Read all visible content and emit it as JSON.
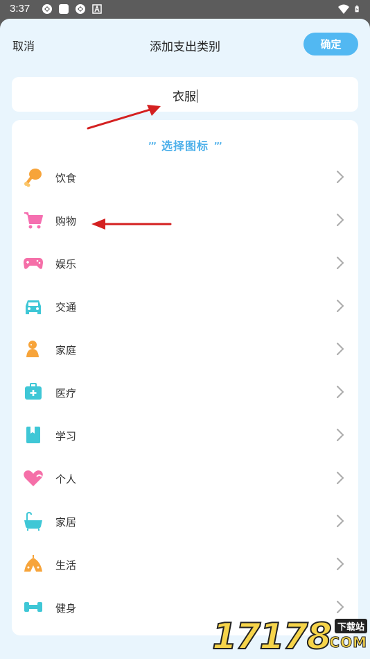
{
  "status_bar": {
    "time": "3:37",
    "left_icons": [
      "sync-icon",
      "square-app-icon",
      "sync-icon",
      "font-a-icon"
    ],
    "right_icons": [
      "wifi-icon",
      "battery-icon"
    ]
  },
  "header": {
    "cancel_label": "取消",
    "title": "添加支出类别",
    "confirm_label": "确定"
  },
  "name_field": {
    "value": "衣服"
  },
  "icon_section": {
    "title": "选择图标",
    "deco": "’’’"
  },
  "categories": [
    {
      "label": "饮食",
      "icon": "drumstick-icon"
    },
    {
      "label": "购物",
      "icon": "shopping-cart-icon"
    },
    {
      "label": "娱乐",
      "icon": "gamepad-icon"
    },
    {
      "label": "交通",
      "icon": "car-icon"
    },
    {
      "label": "家庭",
      "icon": "family-icon"
    },
    {
      "label": "医疗",
      "icon": "medical-kit-icon"
    },
    {
      "label": "学习",
      "icon": "book-icon"
    },
    {
      "label": "个人",
      "icon": "heart-icon"
    },
    {
      "label": "家居",
      "icon": "bathtub-icon"
    },
    {
      "label": "生活",
      "icon": "tent-icon"
    },
    {
      "label": "健身",
      "icon": "dumbbell-icon"
    }
  ],
  "watermark": {
    "digits": "17178",
    "tag": "下载站",
    "com": "COM"
  },
  "colors": {
    "accent": "#52b8f2",
    "sheet_bg": "#e9f5fd",
    "annotation_arrow": "#d42020"
  }
}
